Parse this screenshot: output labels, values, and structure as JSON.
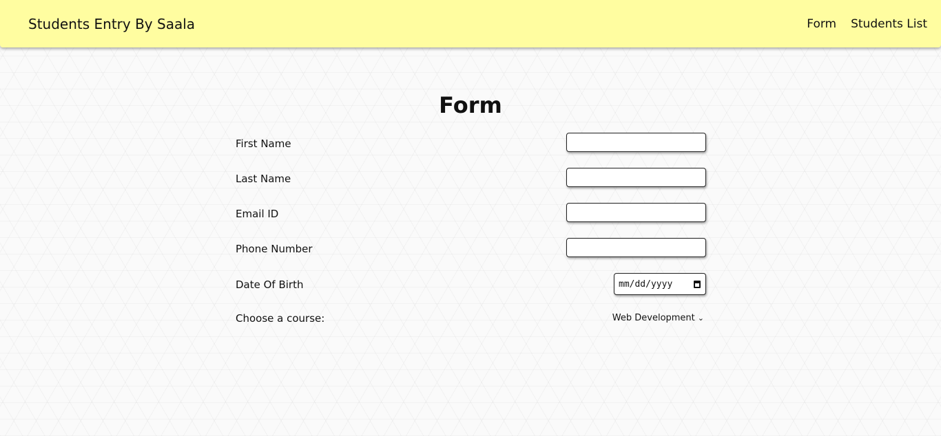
{
  "navbar": {
    "brand": "Students Entry By Saala",
    "links": [
      "Form",
      "Students List"
    ]
  },
  "form": {
    "title": "Form",
    "fields": [
      {
        "label": "First Name",
        "value": ""
      },
      {
        "label": "Last Name",
        "value": ""
      },
      {
        "label": "Email ID",
        "value": ""
      },
      {
        "label": "Phone Number",
        "value": ""
      }
    ],
    "dob": {
      "label": "Date Of Birth",
      "placeholder": "mm/dd/yyyy"
    },
    "course": {
      "label": "Choose a course:",
      "selected": "Web Development"
    }
  },
  "colors": {
    "navbar_bg": "#fffda0",
    "page_bg": "#fafafa"
  }
}
